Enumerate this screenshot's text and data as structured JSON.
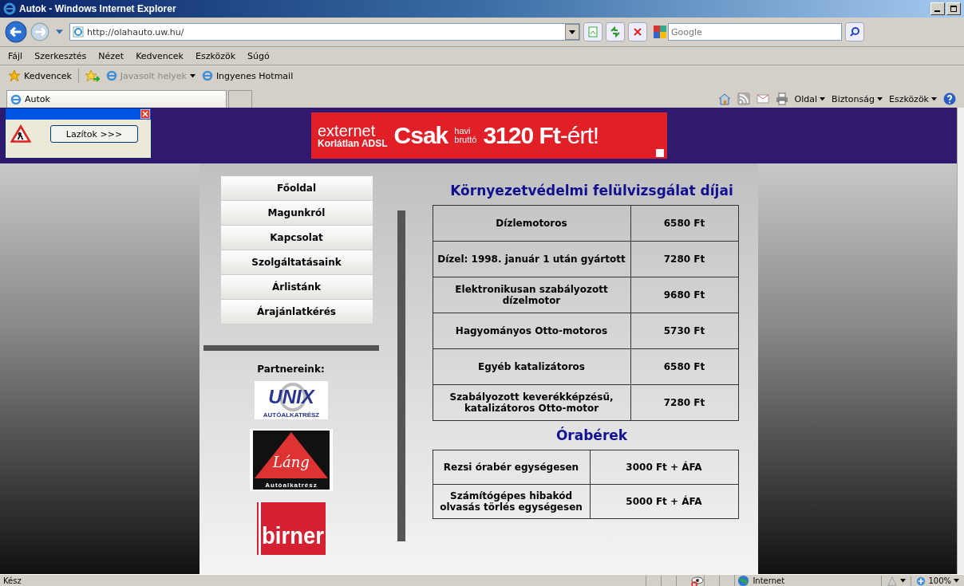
{
  "window": {
    "title": "Autok - Windows Internet Explorer"
  },
  "address_bar": {
    "url": "http://olahauto.uw.hu/",
    "search_placeholder": "Google"
  },
  "menu": [
    "Fájl",
    "Szerkesztés",
    "Nézet",
    "Kedvencek",
    "Eszközök",
    "Súgó"
  ],
  "favorites_bar": {
    "label": "Kedvencek",
    "links": [
      {
        "label": "Javasolt helyek",
        "dropdown": true,
        "disabled": true
      },
      {
        "label": "Ingyenes Hotmail",
        "dropdown": false,
        "disabled": false
      }
    ]
  },
  "tabs": [
    {
      "label": "Autok",
      "selected": true
    }
  ],
  "command_bar": [
    "Oldal",
    "Biztonság",
    "Eszközök"
  ],
  "popup": {
    "button": "Lazítok >>>"
  },
  "banner": {
    "brand": "externet",
    "tagline": "Korlátlan ADSL",
    "lead": "Csak",
    "small_top": "havi",
    "small_bottom": "bruttó",
    "price": "**3120 Ft**-ért!"
  },
  "nav": [
    "Főoldal",
    "Magunkról",
    "Kapcsolat",
    "Szolgáltatásaink",
    "Árlistánk",
    "Árajánlatkérés"
  ],
  "partners": {
    "title": "Partnereink:",
    "logos": [
      {
        "kind": "unix",
        "text": "UNIX",
        "subtext": "AUTÓALKATRÉSZ"
      },
      {
        "kind": "lang",
        "text": "Láng",
        "subtext": "Autóalkatrész"
      },
      {
        "kind": "birner",
        "text": "birner"
      }
    ]
  },
  "sections": [
    {
      "title": "Környezetvédelmi felülvizsgálat díjai",
      "rows": [
        {
          "name": "Dízlemotoros",
          "price": "6580 Ft"
        },
        {
          "name": "Dízel: 1998. január 1 után gyártott",
          "price": "7280 Ft"
        },
        {
          "name": "Elektronikusan szabályozott dízelmotor",
          "price": "9680 Ft"
        },
        {
          "name": "Hagyományos Otto-motoros",
          "price": "5730 Ft"
        },
        {
          "name": "Egyéb katalizátoros",
          "price": "6580 Ft"
        },
        {
          "name": "Szabályozott keverékképzésű, katalizátoros Otto-motor",
          "price": "7280 Ft"
        }
      ]
    },
    {
      "title": "Órabérek",
      "rows": [
        {
          "name": "Rezsi órabér egységesen",
          "price": "3000 Ft + ÁFA"
        },
        {
          "name": "Számítógépes hibakód olvasás törlés egységesen",
          "price": "5000 Ft + ÁFA"
        }
      ]
    }
  ],
  "status_bar": {
    "text": "Kész",
    "zone": "Internet",
    "zoom": "100%"
  }
}
